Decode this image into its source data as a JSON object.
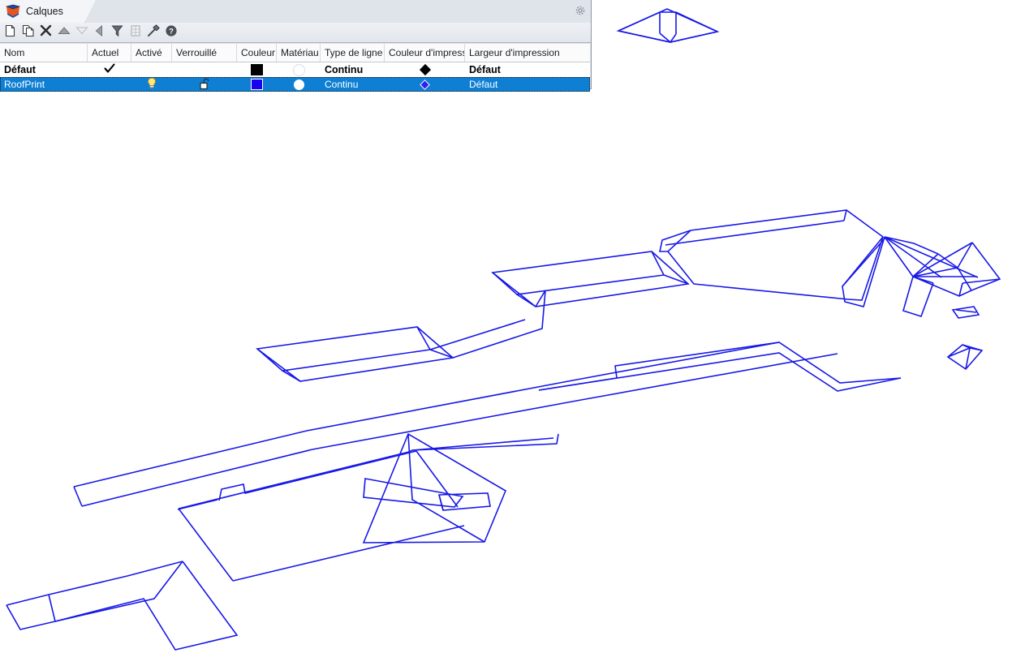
{
  "panel": {
    "tab_label": "Calques",
    "tab_icon": "layers-stack-icon",
    "settings_icon": "gear-icon",
    "toolbar": [
      {
        "name": "new-layer-button",
        "icon": "page-new-icon",
        "enabled": true
      },
      {
        "name": "duplicate-layer-button",
        "icon": "page-copy-icon",
        "enabled": true
      },
      {
        "name": "delete-layer-button",
        "icon": "x-delete-icon",
        "enabled": true
      },
      {
        "name": "move-layer-up-button",
        "icon": "triangle-up-icon",
        "enabled": true
      },
      {
        "name": "move-layer-down-button",
        "icon": "triangle-down-icon",
        "enabled": false
      },
      {
        "name": "set-current-layer-button",
        "icon": "triangle-left-icon",
        "enabled": true
      },
      {
        "name": "layer-filter-button",
        "icon": "funnel-filter-icon",
        "enabled": true
      },
      {
        "name": "layer-states-button",
        "icon": "table-states-icon",
        "enabled": false
      },
      {
        "name": "layer-tools-button",
        "icon": "hammer-tools-icon",
        "enabled": true
      },
      {
        "name": "help-button",
        "icon": "question-help-icon",
        "enabled": true
      }
    ],
    "columns": [
      "Nom",
      "Actuel",
      "Activé",
      "Verrouillé",
      "Couleur",
      "Matériau",
      "Type de ligne",
      "Couleur d'impressi...",
      "Largeur d'impression"
    ],
    "rows": [
      {
        "name": "Défaut",
        "current": "check-mark-icon",
        "on": "",
        "locked": "",
        "color": "#000000",
        "color_icon": "color-swatch-black",
        "material": "material-circle-empty-icon",
        "linetype": "Continu",
        "plot_color": "diamond-black-icon",
        "plot_width": "Défaut",
        "selected": false
      },
      {
        "name": "RoofPrint",
        "current": "",
        "on": "lightbulb-on-icon",
        "locked": "padlock-open-icon",
        "color": "#1800f0",
        "color_icon": "color-swatch-blue",
        "material": "material-circle-white-icon",
        "linetype": "Continu",
        "plot_color": "diamond-blue-icon",
        "plot_width": "Défaut",
        "selected": true
      }
    ],
    "colors": {
      "selection_blue": "#0f7fd4",
      "panel_chrome": "#dfe3ea",
      "layer_color_default": "#000000",
      "layer_color_roofprint": "#1800f0"
    }
  },
  "drawing": {
    "name": "roof-plan-wireframe",
    "line_color": "#1818e8",
    "background": "#ffffff",
    "projection": "isometric",
    "objects": [
      "pyramid-hip-roof-top-right",
      "long-ridge-band-upper",
      "long-ridge-band-middle",
      "long-ridge-band-lower",
      "stepped-roof-outline-left",
      "complex-hip-roof-cluster-right",
      "small-flat-sliver",
      "small-pyramid-roof"
    ]
  }
}
